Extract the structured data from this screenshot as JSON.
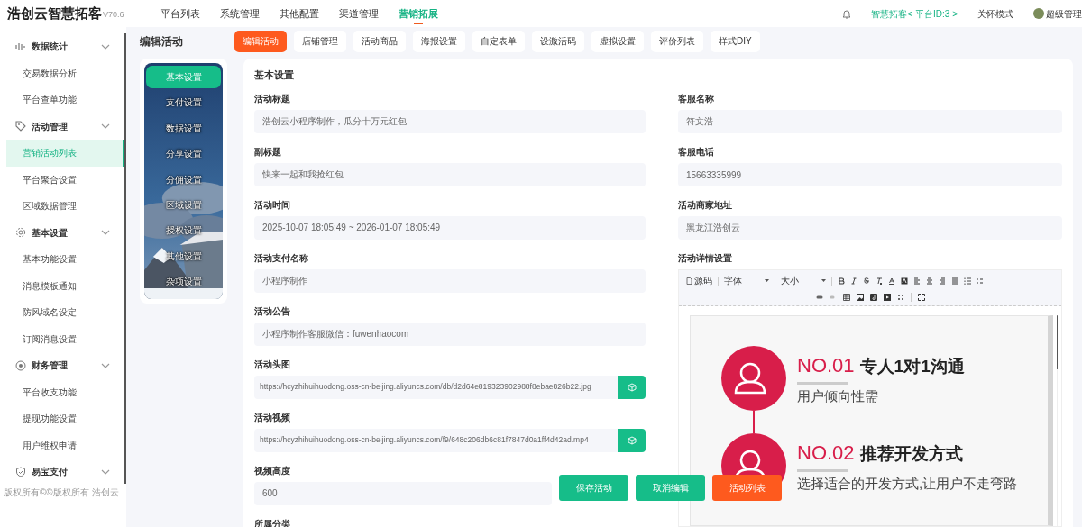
{
  "brand": {
    "name": "浩创云智慧拓客",
    "version": "V70.6"
  },
  "top_nav": [
    {
      "label": "平台列表",
      "selected": false
    },
    {
      "label": "系统管理",
      "selected": false
    },
    {
      "label": "其他配置",
      "selected": false
    },
    {
      "label": "渠道管理",
      "selected": false
    },
    {
      "label": "营销拓展",
      "selected": true
    }
  ],
  "top_right": {
    "platform": "智慧拓客< 平台ID:3 >",
    "care_mode": "关怀模式",
    "user": "超级管理"
  },
  "sidebar": {
    "groups": [
      {
        "label": "数据统计",
        "children": [
          {
            "label": "交易数据分析",
            "selected": false
          },
          {
            "label": "平台查单功能",
            "selected": false
          }
        ]
      },
      {
        "label": "活动管理",
        "children": [
          {
            "label": "营销活动列表",
            "selected": true
          },
          {
            "label": "平台聚合设置",
            "selected": false
          },
          {
            "label": "区域数据管理",
            "selected": false
          }
        ]
      },
      {
        "label": "基本设置",
        "children": [
          {
            "label": "基本功能设置",
            "selected": false
          },
          {
            "label": "消息模板通知",
            "selected": false
          },
          {
            "label": "防风域名设定",
            "selected": false
          },
          {
            "label": "订阅消息设置",
            "selected": false
          }
        ]
      },
      {
        "label": "财务管理",
        "children": [
          {
            "label": "平台收支功能",
            "selected": false
          },
          {
            "label": "提现功能设置",
            "selected": false
          },
          {
            "label": "用户维权申请",
            "selected": false
          }
        ]
      },
      {
        "label": "易宝支付"
      }
    ],
    "footer": "版权所有©©版权所有 浩创云"
  },
  "page_title": "编辑活动",
  "tabs": [
    {
      "label": "编辑活动",
      "selected": true
    },
    {
      "label": "店铺管理",
      "selected": false
    },
    {
      "label": "活动商品",
      "selected": false
    },
    {
      "label": "海报设置",
      "selected": false
    },
    {
      "label": "自定表单",
      "selected": false
    },
    {
      "label": "设激活码",
      "selected": false
    },
    {
      "label": "虚拟设置",
      "selected": false
    },
    {
      "label": "评价列表",
      "selected": false
    },
    {
      "label": "样式DIY",
      "selected": false
    }
  ],
  "settings_nav": [
    {
      "label": "基本设置",
      "selected": true
    },
    {
      "label": "支付设置",
      "selected": false
    },
    {
      "label": "数据设置",
      "selected": false
    },
    {
      "label": "分享设置",
      "selected": false
    },
    {
      "label": "分佣设置",
      "selected": false
    },
    {
      "label": "区域设置",
      "selected": false
    },
    {
      "label": "授权设置",
      "selected": false
    },
    {
      "label": "其他设置",
      "selected": false
    },
    {
      "label": "杂项设置",
      "selected": false
    }
  ],
  "section_title": "基本设置",
  "left_fields": [
    {
      "label": "活动标题",
      "value": "浩创云小程序制作，瓜分十万元红包",
      "kind": "text"
    },
    {
      "label": "副标题",
      "value": "快来一起和我抢红包",
      "kind": "text"
    },
    {
      "label": "活动时间",
      "value": "2025-10-07 18:05:49 ~ 2026-01-07 18:05:49",
      "kind": "text"
    },
    {
      "label": "活动支付名称",
      "value": "小程序制作",
      "kind": "text"
    },
    {
      "label": "活动公告",
      "value": "小程序制作客服微信：fuwenhaocom",
      "kind": "text"
    },
    {
      "label": "活动头图",
      "value": "https://hcyzhihuihuodong.oss-cn-beijing.aliyuncs.com/db/d2d64e819323902988f8ebae826b22.jpg",
      "kind": "upload"
    },
    {
      "label": "活动视频",
      "value": "https://hcyzhihuihuodong.oss-cn-beijing.aliyuncs.com/f9/648c206db6c81f7847d0a1ff4d42ad.mp4",
      "kind": "upload"
    },
    {
      "label": "视频高度",
      "value": "600",
      "kind": "text"
    },
    {
      "label": "所属分类",
      "kind": "label"
    }
  ],
  "right_fields": [
    {
      "label": "客服名称",
      "value": "符文浩"
    },
    {
      "label": "客服电话",
      "value": "15663335999"
    },
    {
      "label": "活动商家地址",
      "value": "黑龙江浩创云"
    }
  ],
  "editor": {
    "label": "活动详情设置",
    "source": "源码",
    "font": "字体",
    "size": "大小",
    "content": [
      {
        "number": "NO.01",
        "title": "专人1对1沟通",
        "subtitle": "用户倾向性需"
      },
      {
        "number": "NO.02",
        "title": "推荐开发方式",
        "subtitle": "选择适合的开发方式,让用户不走弯路"
      }
    ]
  },
  "actions": [
    {
      "label": "保存活动",
      "kind": "primary"
    },
    {
      "label": "取消编辑",
      "kind": "primary"
    },
    {
      "label": "活动列表",
      "kind": "accent"
    }
  ]
}
